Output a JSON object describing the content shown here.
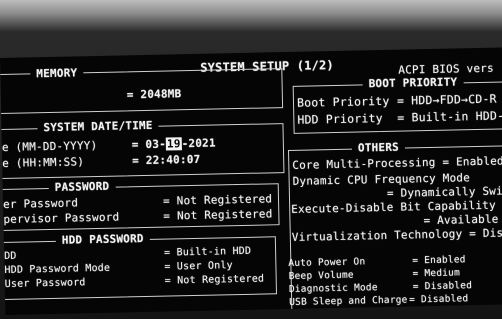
{
  "header": {
    "title": "SYSTEM SETUP (1/2)",
    "acpi": "ACPI BIOS vers"
  },
  "memory": {
    "legend": "MEMORY",
    "value": "= 2048MB"
  },
  "datetime": {
    "legend": "SYSTEM DATE/TIME",
    "date_label": "e (MM-DD-YYYY)",
    "date_month": "= 03-",
    "date_day": "19",
    "date_rest": "-2021",
    "time_label": "e (HH:MM:SS)",
    "time_value": "= 22:40:07"
  },
  "password": {
    "legend": "PASSWORD",
    "rows": [
      {
        "label": "er Password",
        "value": "= Not Registered"
      },
      {
        "label": "pervisor Password",
        "value": "= Not Registered"
      }
    ]
  },
  "hdd_password": {
    "legend": "HDD PASSWORD",
    "rows": [
      {
        "label": "DD",
        "value": "= Built-in HDD"
      },
      {
        "label": "HDD Password Mode",
        "value": "= User Only"
      },
      {
        "label": "User Password",
        "value": "= Not Registered"
      }
    ]
  },
  "boot_priority": {
    "legend": "BOOT PRIORITY",
    "rows": [
      {
        "label": "Boot Priority",
        "value": "= HDD→FDD→CD-R"
      },
      {
        "label": "HDD Priority",
        "value": "= Built-in HDD-"
      }
    ]
  },
  "others": {
    "legend": "OTHERS",
    "lines": [
      "Core Multi-Processing = Enabled",
      "Dynamic CPU Frequency Mode",
      "= Dynamically Switc",
      "Execute-Disable Bit Capability",
      "= Available",
      "Virtualization Technology = Disab"
    ],
    "small_lines": [
      {
        "label": "Auto Power On",
        "value": "= Enabled"
      },
      {
        "label": "Beep Volume",
        "value": "= Medium"
      },
      {
        "label": "Diagnostic Mode",
        "value": "= Disabled"
      },
      {
        "label": "USB Sleep and Charge",
        "value": "= Disabled"
      }
    ]
  }
}
